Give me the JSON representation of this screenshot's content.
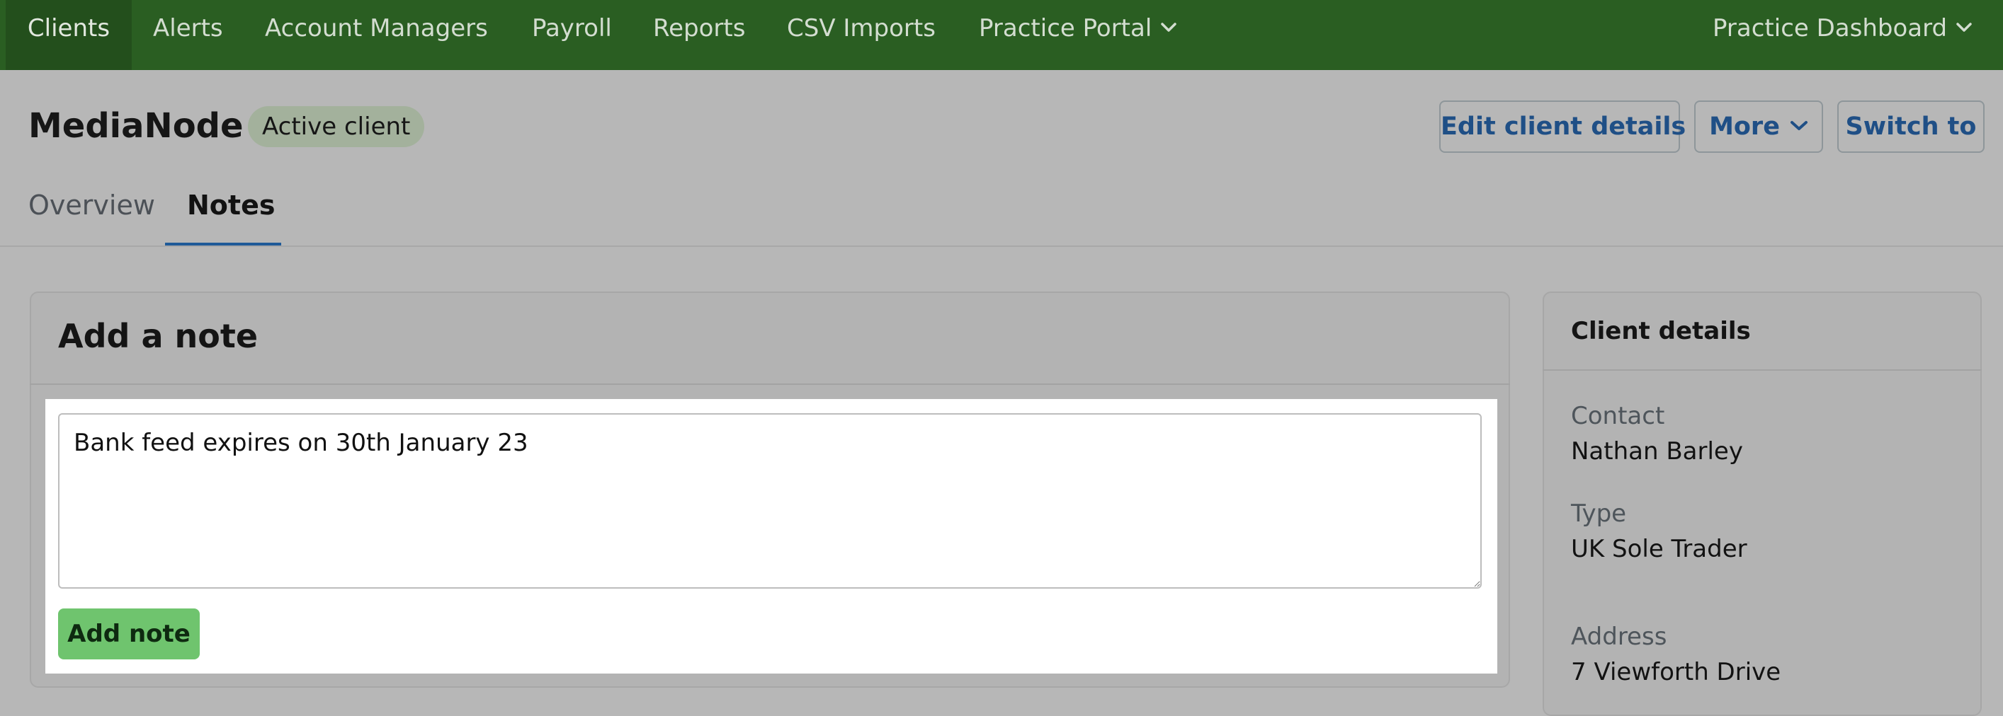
{
  "nav": {
    "items": [
      "Clients",
      "Alerts",
      "Account Managers",
      "Payroll",
      "Reports",
      "CSV Imports",
      "Practice Portal"
    ],
    "right": "Practice Dashboard",
    "active_index": 0
  },
  "client": {
    "name": "MediaNode",
    "status": "Active client"
  },
  "actions": {
    "edit": "Edit client details",
    "more": "More",
    "switch": "Switch to"
  },
  "tabs": {
    "overview": "Overview",
    "notes": "Notes",
    "active": "notes"
  },
  "add_note": {
    "title": "Add a note",
    "note_value": "Bank feed expires on 30th January 23",
    "button": "Add note"
  },
  "details": {
    "title": "Client details",
    "contact_label": "Contact",
    "contact_value": "Nathan Barley",
    "type_label": "Type",
    "type_value": "UK Sole Trader",
    "address_label": "Address",
    "address_value": "7 Viewforth Drive"
  },
  "colors": {
    "nav_bg": "#2a5e22",
    "accent": "#1f5a98",
    "button_green": "#6fc46e",
    "badge": "#a3b19c"
  },
  "icons": {
    "nav_dropdown": "chevron-down-icon",
    "more_dropdown": "chevron-down-icon"
  }
}
